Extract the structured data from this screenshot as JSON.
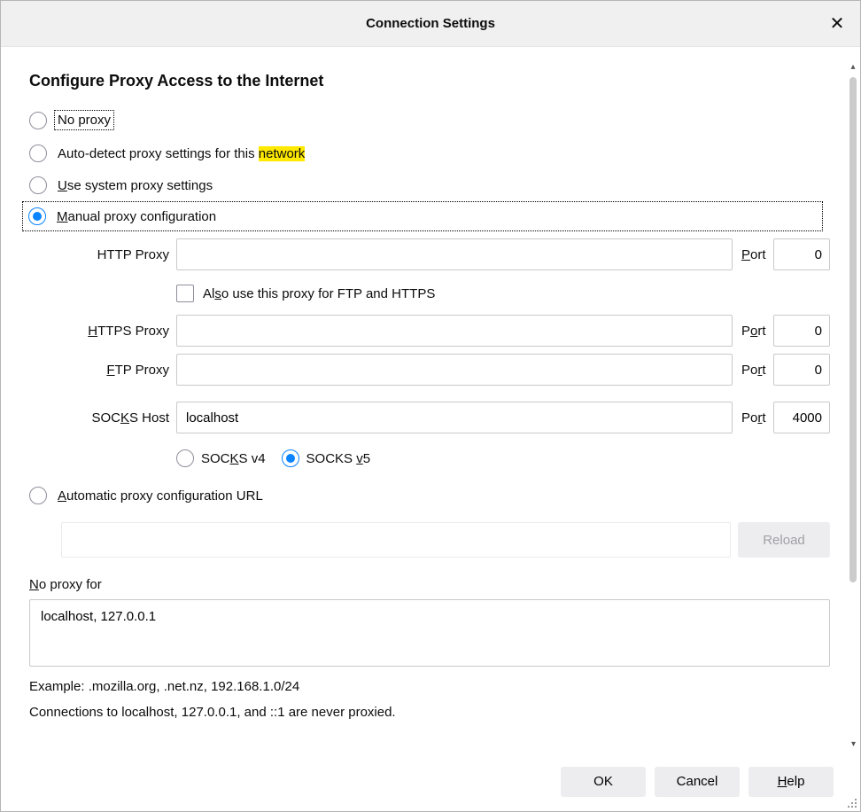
{
  "titlebar": {
    "title": "Connection Settings"
  },
  "section_title": "Configure Proxy Access to the Internet",
  "radios": {
    "no_proxy": "No proxy",
    "auto_detect_prefix": "Auto-detect proxy settings for this ",
    "auto_detect_highlight": "network",
    "use_system_pre": "U",
    "use_system_rest": "se system proxy settings",
    "manual_pre": "M",
    "manual_rest": "anual proxy configuration",
    "auto_url_pre": "A",
    "auto_url_rest": "utomatic proxy configuration URL"
  },
  "fields": {
    "http_label": "HTTP Proxy",
    "http_value": "",
    "http_port": "0",
    "also_use_pre": "Al",
    "also_use_u": "s",
    "also_use_rest": "o use this proxy for FTP and HTTPS",
    "https_pre": "H",
    "https_rest": "TTPS Proxy",
    "https_value": "",
    "https_port": "0",
    "ftp_pre": "F",
    "ftp_rest": "TP Proxy",
    "ftp_value": "",
    "ftp_port": "0",
    "socks_label_pre": "SOC",
    "socks_label_u": "K",
    "socks_label_rest": "S Host",
    "socks_value": "localhost",
    "socks_port": "4000",
    "socks_v4_pre": "SOC",
    "socks_v4_u": "K",
    "socks_v4_rest": "S v4",
    "socks_v5_pre": "SOCKS ",
    "socks_v5_u": "v",
    "socks_v5_rest": "5",
    "port_label_po": "P",
    "port_label_u": "o",
    "port_label_rt": "rt",
    "port_label_po2": "Po",
    "port_label_u2": "r",
    "port_label_t2": "t"
  },
  "reload_label": "Reload",
  "no_proxy_for": {
    "label_pre": "N",
    "label_rest": "o proxy for",
    "value": "localhost, 127.0.0.1",
    "example": "Example: .mozilla.org, .net.nz, 192.168.1.0/24",
    "note": "Connections to localhost, 127.0.0.1, and ::1 are never proxied."
  },
  "buttons": {
    "ok": "OK",
    "cancel": "Cancel",
    "help_pre": "H",
    "help_rest": "elp"
  }
}
